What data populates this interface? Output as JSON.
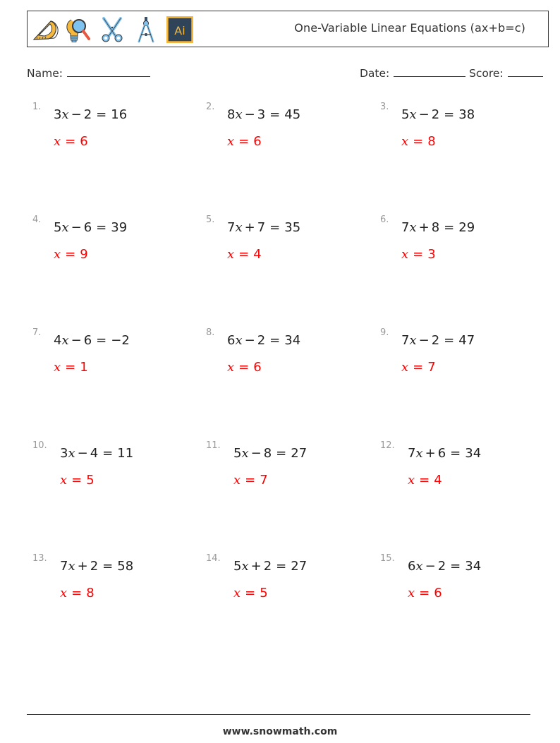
{
  "header": {
    "icons": [
      "protractor-icon",
      "lightbulb-magnifier-icon",
      "scissors-icon",
      "compass-icon",
      "adobe-illustrator-icon"
    ],
    "title": "One-Variable Linear Equations (ax+b=c)"
  },
  "fields": {
    "name_label": "Name:",
    "date_label": "Date:",
    "score_label": "Score:"
  },
  "variable": "x",
  "problems": [
    {
      "num": "1.",
      "coef": "3",
      "op": "−",
      "b": "2",
      "c": "16",
      "answer": "6"
    },
    {
      "num": "2.",
      "coef": "8",
      "op": "−",
      "b": "3",
      "c": "45",
      "answer": "6"
    },
    {
      "num": "3.",
      "coef": "5",
      "op": "−",
      "b": "2",
      "c": "38",
      "answer": "8"
    },
    {
      "num": "4.",
      "coef": "5",
      "op": "−",
      "b": "6",
      "c": "39",
      "answer": "9"
    },
    {
      "num": "5.",
      "coef": "7",
      "op": "+",
      "b": "7",
      "c": "35",
      "answer": "4"
    },
    {
      "num": "6.",
      "coef": "7",
      "op": "+",
      "b": "8",
      "c": "29",
      "answer": "3"
    },
    {
      "num": "7.",
      "coef": "4",
      "op": "−",
      "b": "6",
      "c": "−2",
      "answer": "1"
    },
    {
      "num": "8.",
      "coef": "6",
      "op": "−",
      "b": "2",
      "c": "34",
      "answer": "6"
    },
    {
      "num": "9.",
      "coef": "7",
      "op": "−",
      "b": "2",
      "c": "47",
      "answer": "7"
    },
    {
      "num": "10.",
      "coef": "3",
      "op": "−",
      "b": "4",
      "c": "11",
      "answer": "5"
    },
    {
      "num": "11.",
      "coef": "5",
      "op": "−",
      "b": "8",
      "c": "27",
      "answer": "7"
    },
    {
      "num": "12.",
      "coef": "7",
      "op": "+",
      "b": "6",
      "c": "34",
      "answer": "4"
    },
    {
      "num": "13.",
      "coef": "7",
      "op": "+",
      "b": "2",
      "c": "58",
      "answer": "8"
    },
    {
      "num": "14.",
      "coef": "5",
      "op": "+",
      "b": "2",
      "c": "27",
      "answer": "5"
    },
    {
      "num": "15.",
      "coef": "6",
      "op": "−",
      "b": "2",
      "c": "34",
      "answer": "6"
    }
  ],
  "colors": {
    "answer": "#ff0000",
    "problem_number": "#999999"
  },
  "footer": {
    "url": "www.snowmath.com"
  }
}
